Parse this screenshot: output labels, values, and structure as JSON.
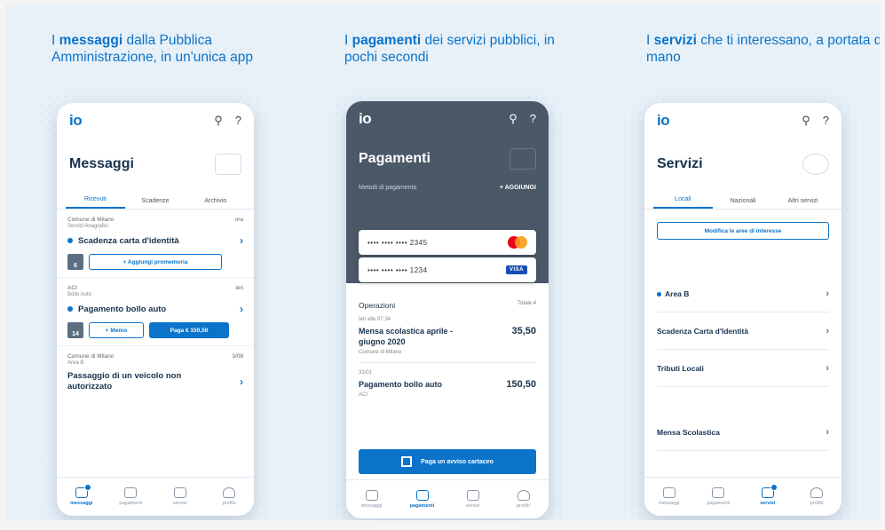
{
  "panels": {
    "messages": {
      "headline_pre": "I ",
      "headline_bold": "messaggi",
      "headline_post": " dalla Pubblica Amministrazione, in un'unica app",
      "logo": "io",
      "search_icon": "search-icon",
      "help_label": "?",
      "title": "Messaggi",
      "tabs": [
        "Ricevuti",
        "Scadenze",
        "Archivio"
      ],
      "items": [
        {
          "sender": "Comune di Milano",
          "service": "Servizi Anagrafici",
          "time": "ora",
          "title": "Scadenza carta d'identità",
          "cal_day": "6",
          "reminder_label": "+ Aggiungi promemoria"
        },
        {
          "sender": "ACI",
          "service": "Bollo Auto",
          "time": "ieri",
          "title": "Pagamento bollo auto",
          "cal_day": "14",
          "memo_label": "+ Memo",
          "pay_label": "Paga € 150,50"
        },
        {
          "sender": "Comune di Milano",
          "service": "Area B",
          "time": "3/08",
          "title": "Passaggio di un veicolo non autorizzato"
        }
      ]
    },
    "payments": {
      "headline_pre": "I ",
      "headline_bold": "pagamenti",
      "headline_post": " dei servizi pubblici, in pochi secondi",
      "logo": "io",
      "help_label": "?",
      "title": "Pagamenti",
      "methods_label": "Metodi di pagamento",
      "add_label": "+ AGGIUNGI",
      "cards": [
        {
          "number": "•••• •••• •••• 2345",
          "brand": "mastercard"
        },
        {
          "number": "•••• •••• •••• 1234",
          "brand": "VISA"
        }
      ],
      "ops_label": "Operazioni",
      "ops_total": "Totale 4",
      "operations": [
        {
          "date": "Ieri alle 07.34",
          "title": "Mensa scolastica aprile -giugno 2020",
          "amount": "35,50",
          "payee": "Comune di Milano"
        },
        {
          "date": "31/01",
          "title": "Pagamento bollo auto",
          "amount": "150,50",
          "payee": "ACI"
        }
      ],
      "pay_button": "Paga un avviso cartaceo"
    },
    "services": {
      "headline_pre": "I ",
      "headline_bold": "servizi",
      "headline_post": " che ti interessano, a portata di mano",
      "logo": "io",
      "help_label": "?",
      "title": "Servizi",
      "tabs": [
        "Locali",
        "Nazionali",
        "Altri servizi"
      ],
      "modify_label": "Modifica le aree di interesse",
      "items": [
        "Area B",
        "Scadenza Carta d'Identità",
        "Tributi Locali",
        "Mensa Scolastica"
      ]
    }
  },
  "nav": {
    "labels": [
      "messaggi",
      "pagamenti",
      "servizi",
      "profilo"
    ]
  },
  "colors": {
    "accent": "#0b73c9",
    "dark_header": "#4a5867",
    "text": "#17324d"
  }
}
